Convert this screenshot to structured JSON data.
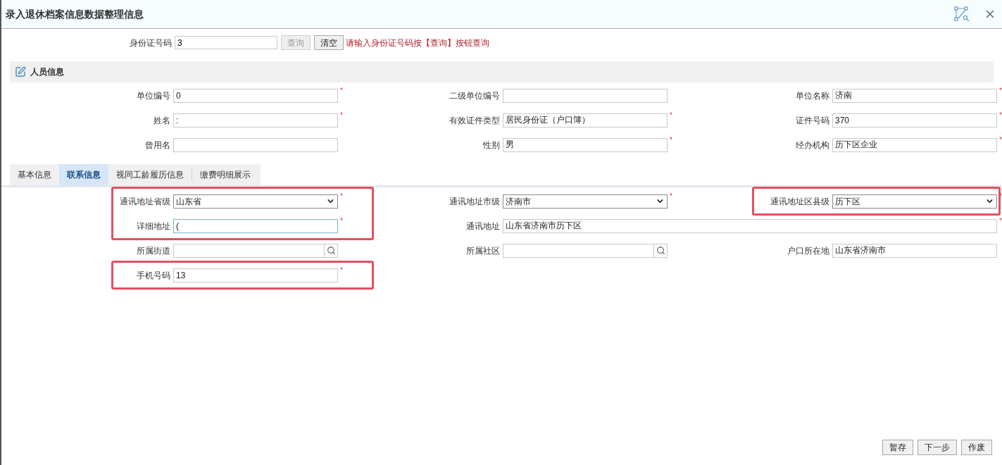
{
  "window": {
    "title": "录入退休档案信息数据整理信息"
  },
  "id_search": {
    "label": "身份证号码",
    "value": "3",
    "buttons": [
      {
        "label": "查询",
        "disabled": true
      },
      {
        "label": "清空",
        "disabled": false
      }
    ],
    "hint": "请输入身份证号码按【查询】按钮查询"
  },
  "person_section": {
    "title": "人员信息",
    "rows": [
      [
        {
          "label": "单位编号",
          "kind": "text",
          "value": "0",
          "required_mark": "*"
        },
        {
          "label": "二级单位编号",
          "kind": "text"
        },
        {
          "label": "单位名称",
          "kind": "text",
          "value": "济南",
          "required_mark": "*"
        }
      ],
      [
        {
          "label": "姓名",
          "kind": "text",
          "value": ":",
          "required_mark": "*"
        },
        {
          "label": "有效证件类型",
          "kind": "text",
          "value": "居民身份证（户口簿）",
          "required_mark": "*"
        },
        {
          "label": "证件号码",
          "kind": "text",
          "value": "370",
          "required_mark": "*"
        }
      ],
      [
        {
          "label": "曾用名",
          "kind": "text"
        },
        {
          "label": "性别",
          "kind": "text",
          "value": "男",
          "required_mark": "*"
        },
        {
          "label": "经办机构",
          "kind": "text",
          "value": "历下区企业",
          "required_mark": "*"
        }
      ]
    ]
  },
  "tabs": [
    {
      "label": "基本信息",
      "selected": false
    },
    {
      "label": "联系信息",
      "selected": true
    },
    {
      "label": "视同工龄履历信息",
      "selected": false
    },
    {
      "label": "缴费明细展示",
      "selected": false
    }
  ],
  "contact": {
    "rows": [
      [
        {
          "label": "通讯地址省级",
          "kind": "select",
          "value": "山东省",
          "required_mark": "*",
          "highlighted": true,
          "focused": false,
          "wide": false
        },
        {
          "label": "通讯地址市级",
          "kind": "select",
          "value": "济南市",
          "required_mark": "*",
          "highlighted": false,
          "focused": false,
          "wide": false
        },
        {
          "label": "通讯地址区县级",
          "kind": "select",
          "value": "历下区",
          "required_mark": "*",
          "highlighted": true,
          "focused": false,
          "wide": false
        }
      ],
      [
        {
          "label": "详细地址",
          "kind": "text",
          "value": "(",
          "required_mark": "*",
          "highlighted": true,
          "focused": true,
          "wide": false
        },
        {
          "label": "通讯地址",
          "kind": "text",
          "value": "山东省济南市历下区",
          "required_mark": "*",
          "highlighted": false,
          "focused": false,
          "wide": true
        }
      ],
      [
        {
          "label": "所属街道",
          "kind": "lookup",
          "highlighted": false,
          "focused": false,
          "wide": false
        },
        {
          "label": "所属社区",
          "kind": "lookup",
          "highlighted": false,
          "focused": false,
          "wide": false
        },
        {
          "label": "户口所在地",
          "kind": "text",
          "value": "山东省济南市",
          "highlighted": false,
          "focused": false,
          "wide": false
        }
      ],
      [
        {
          "label": "手机号码",
          "kind": "text",
          "value": "13",
          "required_mark": "*",
          "highlighted": true,
          "focused": false,
          "wide": false
        }
      ]
    ]
  },
  "footer_buttons": [
    {
      "label": "暂存"
    },
    {
      "label": "下一步"
    },
    {
      "label": "作废"
    }
  ]
}
